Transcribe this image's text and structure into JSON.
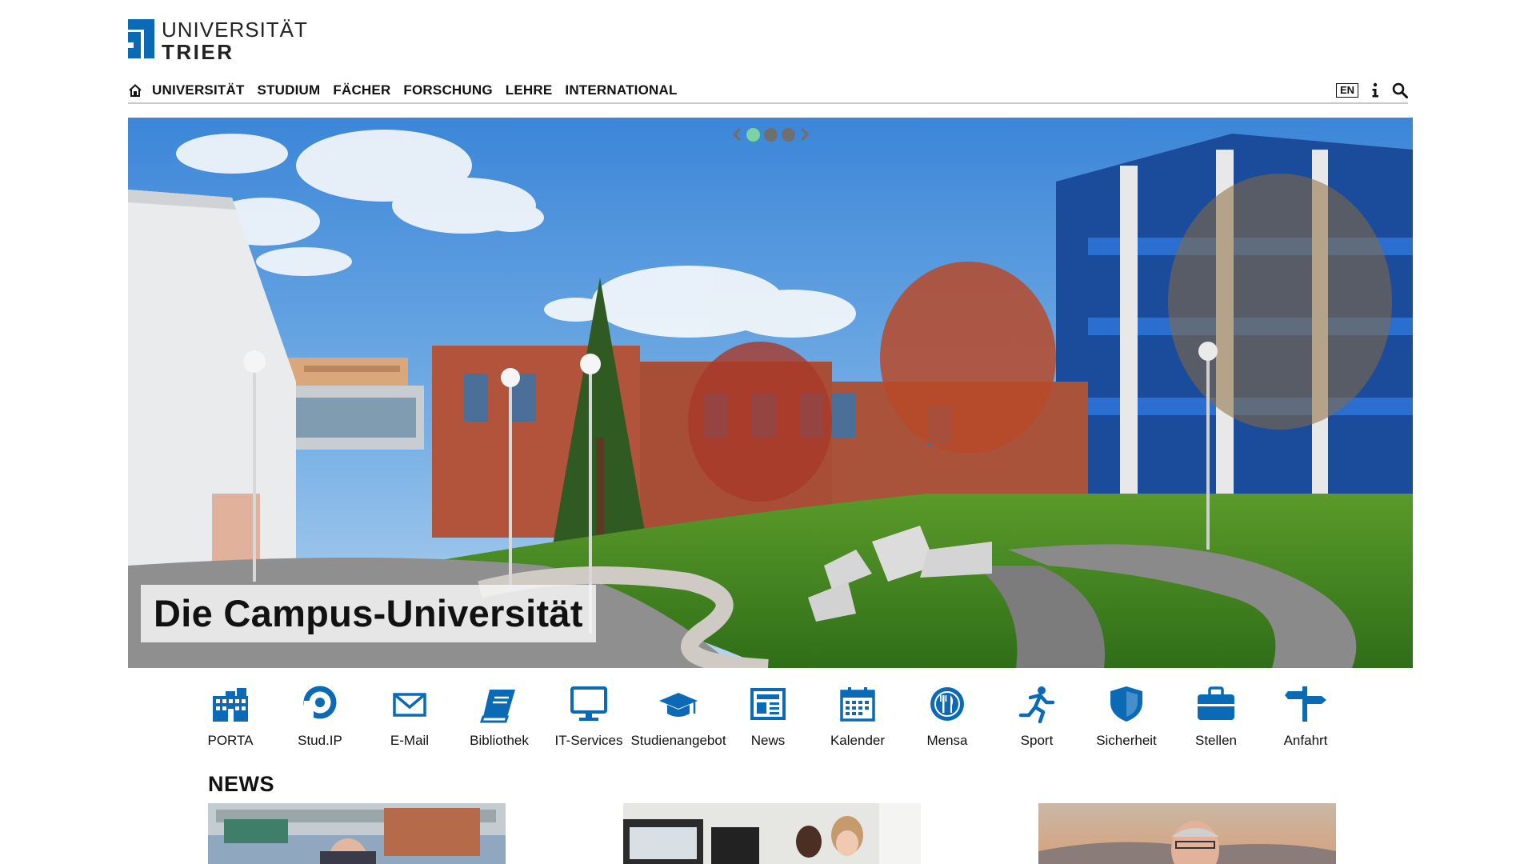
{
  "logo": {
    "line1": "UNIVERSITÄT",
    "line2": "TRIER",
    "brand_color": "#0a6ab6"
  },
  "nav": {
    "home_icon": "home-icon",
    "items": [
      {
        "label": "UNIVERSITÄT"
      },
      {
        "label": "STUDIUM"
      },
      {
        "label": "FÄCHER"
      },
      {
        "label": "FORSCHUNG"
      },
      {
        "label": "LEHRE"
      },
      {
        "label": "INTERNATIONAL"
      }
    ],
    "language": "EN",
    "info_icon": "info-icon",
    "search_icon": "search-icon"
  },
  "hero": {
    "caption": "Die Campus-Universität",
    "slides_total": 3,
    "active_slide": 1,
    "active_dot_color": "#7cd3a2",
    "inactive_dot_color": "#6f6f6f"
  },
  "quicklinks": {
    "icon_color": "#0a6ab6",
    "items": [
      {
        "label": "PORTA",
        "icon": "building-icon"
      },
      {
        "label": "Stud.IP",
        "icon": "studip-icon"
      },
      {
        "label": "E-Mail",
        "icon": "mail-icon"
      },
      {
        "label": "Bibliothek",
        "icon": "book-icon"
      },
      {
        "label": "IT-Services",
        "icon": "monitor-icon"
      },
      {
        "label": "Studienangebot",
        "icon": "graduation-cap-icon"
      },
      {
        "label": "News",
        "icon": "newspaper-icon"
      },
      {
        "label": "Kalender",
        "icon": "calendar-icon"
      },
      {
        "label": "Mensa",
        "icon": "cutlery-icon"
      },
      {
        "label": "Sport",
        "icon": "running-icon"
      },
      {
        "label": "Sicherheit",
        "icon": "shield-icon"
      },
      {
        "label": "Stellen",
        "icon": "briefcase-icon"
      },
      {
        "label": "Anfahrt",
        "icon": "signpost-icon"
      }
    ]
  },
  "news": {
    "heading": "NEWS"
  }
}
